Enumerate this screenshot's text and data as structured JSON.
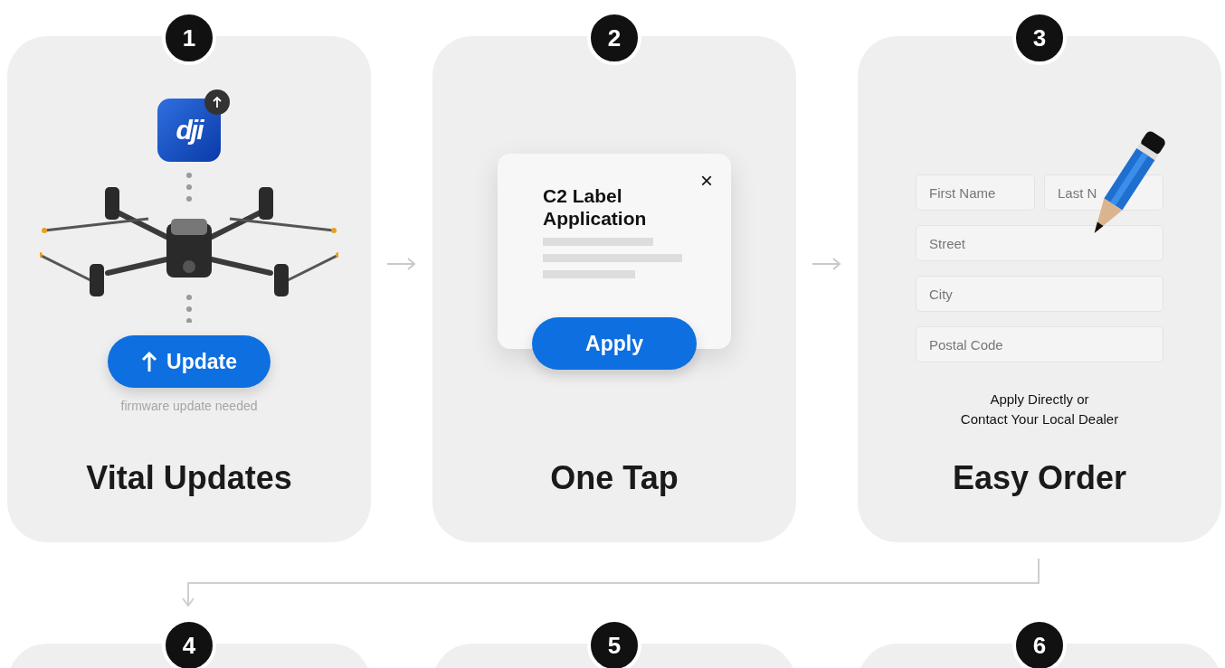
{
  "steps": [
    {
      "number": "1",
      "kind": "update",
      "title": "Vital Updates",
      "app_logo": "dji",
      "button": "Update",
      "note": "firmware update needed"
    },
    {
      "number": "2",
      "kind": "apply",
      "title": "One Tap",
      "dialog_title": "C2 Label Application",
      "close": "×",
      "button": "Apply"
    },
    {
      "number": "3",
      "kind": "form",
      "title": "Easy Order",
      "fields": [
        {
          "placeholder": "First Name"
        },
        {
          "placeholder": "Last N"
        },
        {
          "placeholder": "Street"
        },
        {
          "placeholder": "City"
        },
        {
          "placeholder": "Postal Code"
        }
      ],
      "note": "Apply Directly or\nContact Your Local Dealer"
    }
  ],
  "next_steps": [
    {
      "number": "4"
    },
    {
      "number": "5"
    },
    {
      "number": "6"
    }
  ]
}
